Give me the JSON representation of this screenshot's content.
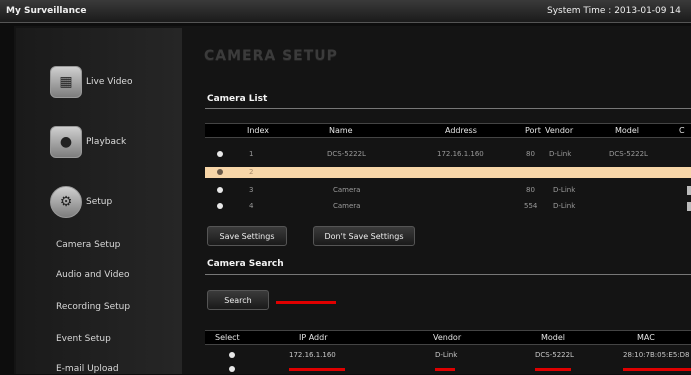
{
  "app_title": "My Surveillance",
  "system_time": "System Time : 2013-01-09 14",
  "sidebar": {
    "big": [
      {
        "label": "Live Video",
        "icon": "live-video-icon"
      },
      {
        "label": "Playback",
        "icon": "playback-icon"
      },
      {
        "label": "Setup",
        "icon": "gear-icon"
      }
    ],
    "items": [
      "Camera Setup",
      "Audio and Video",
      "Recording Setup",
      "Event Setup",
      "E-mail Upload"
    ]
  },
  "page_title": "CAMERA SETUP",
  "camera_list": {
    "title": "Camera List",
    "headers": [
      "Index",
      "Name",
      "Address",
      "Port",
      "Vendor",
      "Model",
      "C"
    ],
    "rows": [
      {
        "index": "1",
        "name": "DCS-5222L",
        "address": "172.16.1.160",
        "port": "80",
        "vendor": "D-Link",
        "model": "DCS-5222L",
        "highlight": false
      },
      {
        "index": "2",
        "name": "",
        "address": "",
        "port": "",
        "vendor": "",
        "model": "",
        "highlight": true
      },
      {
        "index": "3",
        "name": "Camera",
        "address": "",
        "port": "80",
        "vendor": "D-Link",
        "model": "",
        "highlight": false
      },
      {
        "index": "4",
        "name": "Camera",
        "address": "",
        "port": "554",
        "vendor": "D-Link",
        "model": "",
        "highlight": false
      }
    ]
  },
  "buttons": {
    "save": "Save Settings",
    "dont_save": "Don't Save Settings",
    "search": "Search"
  },
  "camera_search": {
    "title": "Camera Search",
    "headers": [
      "Select",
      "IP Addr",
      "Vendor",
      "Model",
      "MAC"
    ],
    "rows": [
      {
        "ip": "172.16.1.160",
        "vendor": "D-Link",
        "model": "DCS-5222L",
        "mac": "28:10:7B:05:E5:D8",
        "red": false
      },
      {
        "ip": "",
        "vendor": "",
        "model": "",
        "mac": "",
        "red": true
      }
    ]
  },
  "colors": {
    "highlight_row": "#f7d6a8",
    "alert_red": "#e00000"
  }
}
